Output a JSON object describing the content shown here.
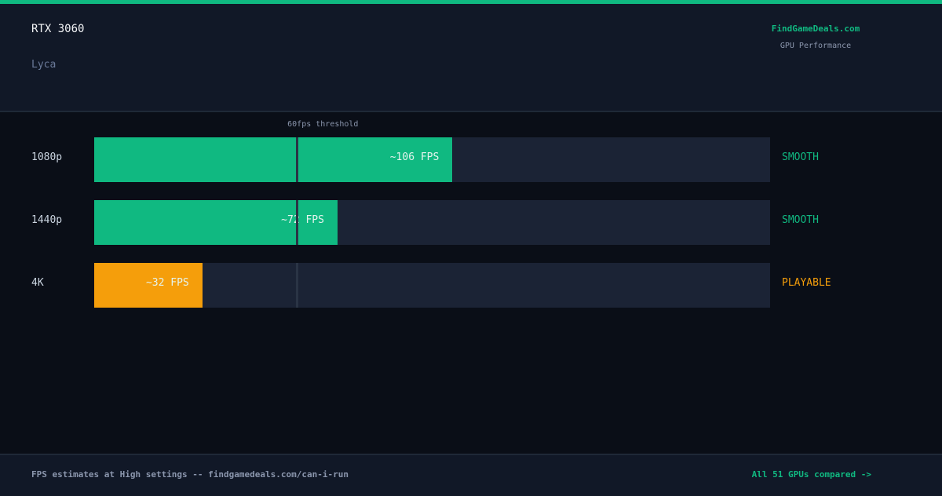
{
  "header": {
    "gpu": "RTX 3060",
    "game": "Lyca",
    "brand": "FindGameDeals.com",
    "brand_sub": "GPU Performance"
  },
  "chart_data": {
    "type": "bar",
    "orientation": "horizontal",
    "categories": [
      "1080p",
      "1440p",
      "4K"
    ],
    "values": [
      106,
      72,
      32
    ],
    "value_labels": [
      "~106 FPS",
      "~72 FPS",
      "~32 FPS"
    ],
    "status": [
      "SMOOTH",
      "SMOOTH",
      "PLAYABLE"
    ],
    "xlim": [
      0,
      200
    ],
    "threshold": {
      "value": 60,
      "label": "60fps threshold"
    },
    "colors": {
      "smooth": "#10b981",
      "playable": "#f59e0b",
      "track": "#1b2335",
      "threshold": "#2a3445"
    }
  },
  "footer": {
    "left": "FPS estimates at High settings -- findgamedeals.com/can-i-run",
    "right": "All 51 GPUs compared ->"
  }
}
